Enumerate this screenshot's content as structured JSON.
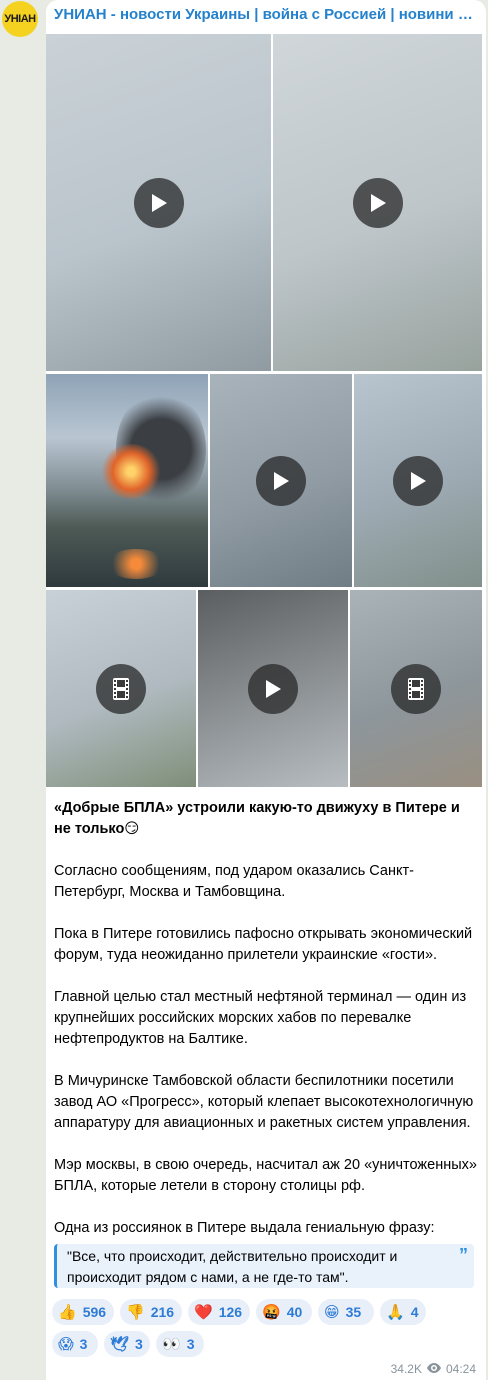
{
  "channel": {
    "avatar_text": "УНІАН",
    "name": "УНИАН - новости Украины | война с Россией | новини Україні..."
  },
  "media": [
    {
      "kind": "video",
      "icon": "play-icon",
      "colors": [
        "#c9d2d8",
        "#b9c4cc",
        "#8f9aa2"
      ]
    },
    {
      "kind": "video",
      "icon": "play-icon",
      "colors": [
        "#cfd6da",
        "#bdc6cb",
        "#97a29d"
      ]
    },
    {
      "kind": "photo",
      "icon": "none",
      "colors": [
        "#8fa3b6",
        "#3b3f44",
        "#e0642a"
      ]
    },
    {
      "kind": "video",
      "icon": "play-icon",
      "colors": [
        "#a7b3bc",
        "#8f9ba5",
        "#6f7d86"
      ]
    },
    {
      "kind": "video",
      "icon": "play-icon",
      "colors": [
        "#b7c5d0",
        "#9ba9b3",
        "#80908a"
      ]
    },
    {
      "kind": "gif",
      "icon": "film-icon",
      "colors": [
        "#c7d1d8",
        "#aeb9c0",
        "#7e8f77"
      ]
    },
    {
      "kind": "video",
      "icon": "play-icon",
      "colors": [
        "#5b5e60",
        "#8e9396",
        "#b7bdc0"
      ]
    },
    {
      "kind": "gif",
      "icon": "film-icon",
      "colors": [
        "#a9b3b9",
        "#8c969c",
        "#9b8f7f"
      ]
    }
  ],
  "post": {
    "headline": "«Добрые БПЛА» устроили какую-то движуху в Питере и не только😏",
    "paragraphs": [
      "Согласно сообщениям, под ударом оказались Санкт-Петербург, Москва и Тамбовщина.",
      "Пока в Питере готовились пафосно открывать экономический форум, туда неожиданно прилетели украинские «гости».",
      "Главной целью стал местный нефтяной терминал — один из крупнейших российских морских хабов по перевалке нефтепродуктов на Балтике.",
      "В Мичуринске Тамбовской области беспилотники посетили завод АО «Прогресс», который клепает высокотехнологичную аппаратуру для авиационных и ракетных систем управления.",
      "Мэр москвы, в свою очередь, насчитал аж 20 «уничтоженных» БПЛА, которые летели в сторону столицы рф.",
      "Одна из россиянок в Питере выдала гениальную фразу:"
    ],
    "quote": "\"Все, что происходит, действительно происходит и происходит рядом с нами, а не где-то там\"."
  },
  "reactions": [
    {
      "emoji": "👍",
      "count": "596"
    },
    {
      "emoji": "👎",
      "count": "216"
    },
    {
      "emoji": "❤️",
      "count": "126"
    },
    {
      "emoji": "🤬",
      "count": "40"
    },
    {
      "emoji": "😁",
      "count": "35"
    },
    {
      "emoji": "🙏",
      "count": "4"
    },
    {
      "emoji": "😱",
      "count": "3"
    },
    {
      "emoji": "🕊",
      "count": "3"
    },
    {
      "emoji": "👀",
      "count": "3"
    }
  ],
  "meta": {
    "views": "34.2K",
    "time": "04:24"
  }
}
